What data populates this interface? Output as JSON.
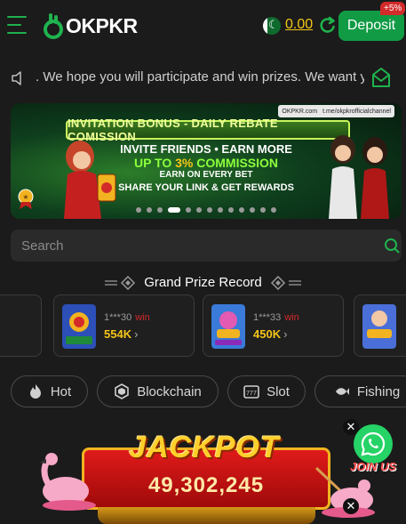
{
  "header": {
    "logo_ok": "OK",
    "logo_pkr": "PKR",
    "balance": "0.00",
    "deposit_label": "Deposit",
    "deposit_badge": "+5%"
  },
  "marquee": {
    "text": ". We hope you will participate and win prizes. We want y"
  },
  "banner": {
    "tag_site": "OKPKR.com",
    "tag_channel": "t.me/okpkrofficialchannel",
    "title": "INVITATION BONUS - DAILY REBATE COMISSION",
    "line1": "INVITE FRIENDS • EARN MORE",
    "line2_prefix": "UP TO ",
    "line2_num": "3%",
    "line2_suffix": " COMMISSION",
    "line3": "EARN ON EVERY BET",
    "line4": "SHARE YOUR LINK & GET REWARDS",
    "slides": 13,
    "active_slide": 3
  },
  "search": {
    "placeholder": "Search"
  },
  "grand_prize": {
    "title": "Grand Prize Record",
    "records": [
      {
        "user": "",
        "win_label": "",
        "amount": ""
      },
      {
        "user": "1***30",
        "win_label": "win",
        "amount": "554K"
      },
      {
        "user": "1***33",
        "win_label": "win",
        "amount": "450K"
      },
      {
        "user": "",
        "win_label": "",
        "amount": ""
      }
    ]
  },
  "categories": [
    {
      "label": "Hot",
      "icon": "flame-icon"
    },
    {
      "label": "Blockchain",
      "icon": "blockchain-icon"
    },
    {
      "label": "Slot",
      "icon": "slot-icon"
    },
    {
      "label": "Fishing",
      "icon": "fish-icon"
    }
  ],
  "jackpot": {
    "title": "JACKPOT",
    "value": "49,302,245"
  },
  "whatsapp": {
    "join_label": "JOIN US"
  },
  "colors": {
    "brand_green": "#119b45",
    "gold": "#f5c518",
    "win_red": "#d32a2a",
    "background": "#1b1b1b"
  }
}
